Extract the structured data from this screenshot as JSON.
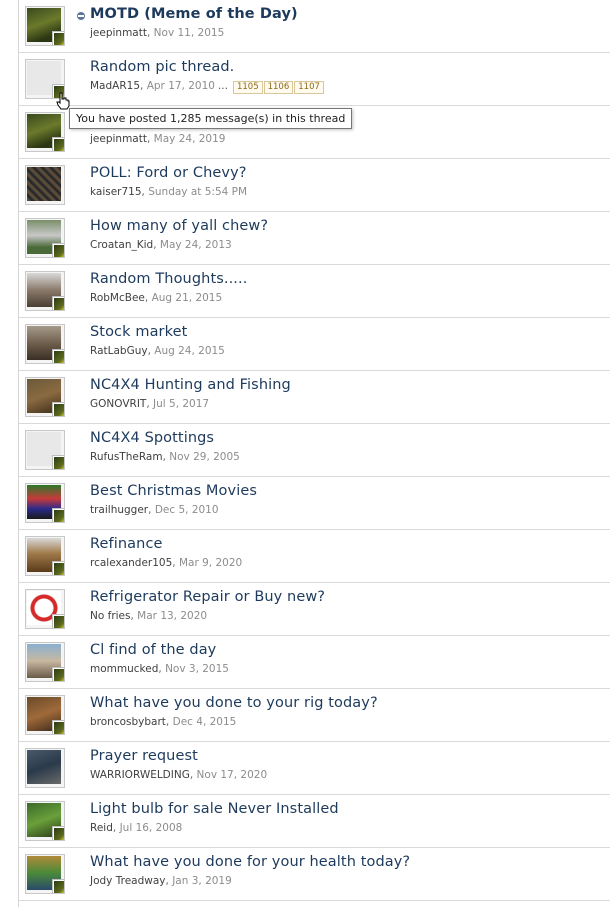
{
  "threads": [
    {
      "title": "MOTD (Meme of the Day)",
      "user": "jeepinmatt",
      "date": "Nov 11, 2015",
      "sticky": true
    },
    {
      "title": "Random pic thread.",
      "user": "MadAR15",
      "date": "Apr 17, 2010",
      "pages": [
        "1105",
        "1106",
        "1107"
      ],
      "ellipsis": "..."
    },
    {
      "title": "",
      "user": "jeepinmatt",
      "date": "May 24, 2019"
    },
    {
      "title": "POLL: Ford or Chevy?",
      "user": "kaiser715",
      "date": "Sunday at 5:54 PM"
    },
    {
      "title": "How many of yall chew?",
      "user": "Croatan_Kid",
      "date": "May 24, 2013"
    },
    {
      "title": "Random Thoughts.....",
      "user": "RobMcBee",
      "date": "Aug 21, 2015"
    },
    {
      "title": "Stock market",
      "user": "RatLabGuy",
      "date": "Aug 24, 2015"
    },
    {
      "title": "NC4X4 Hunting and Fishing",
      "user": "GONOVRIT",
      "date": "Jul 5, 2017"
    },
    {
      "title": "NC4X4 Spottings",
      "user": "RufusTheRam",
      "date": "Nov 29, 2005"
    },
    {
      "title": "Best Christmas Movies",
      "user": "trailhugger",
      "date": "Dec 5, 2010"
    },
    {
      "title": "Refinance",
      "user": "rcalexander105",
      "date": "Mar 9, 2020"
    },
    {
      "title": "Refrigerator Repair or Buy new?",
      "user": "No fries",
      "date": "Mar 13, 2020"
    },
    {
      "title": "Cl find of the day",
      "user": "mommucked",
      "date": "Nov 3, 2015"
    },
    {
      "title": "What have you done to your rig today?",
      "user": "broncosbybart",
      "date": "Dec 4, 2015"
    },
    {
      "title": "Prayer request",
      "user": "WARRIORWELDING",
      "date": "Nov 17, 2020"
    },
    {
      "title": "Light bulb for sale Never Installed",
      "user": "Reid",
      "date": "Jul 16, 2008"
    },
    {
      "title": "What have you done for your health today?",
      "user": "Jody Treadway",
      "date": "Jan 3, 2019"
    }
  ],
  "tooltip": {
    "text": "You have posted 1,285 message(s) in this thread"
  },
  "colors": {
    "title": "#1d3a5c",
    "meta": "#6b6b6b",
    "page_box_border": "#d8c79a"
  }
}
